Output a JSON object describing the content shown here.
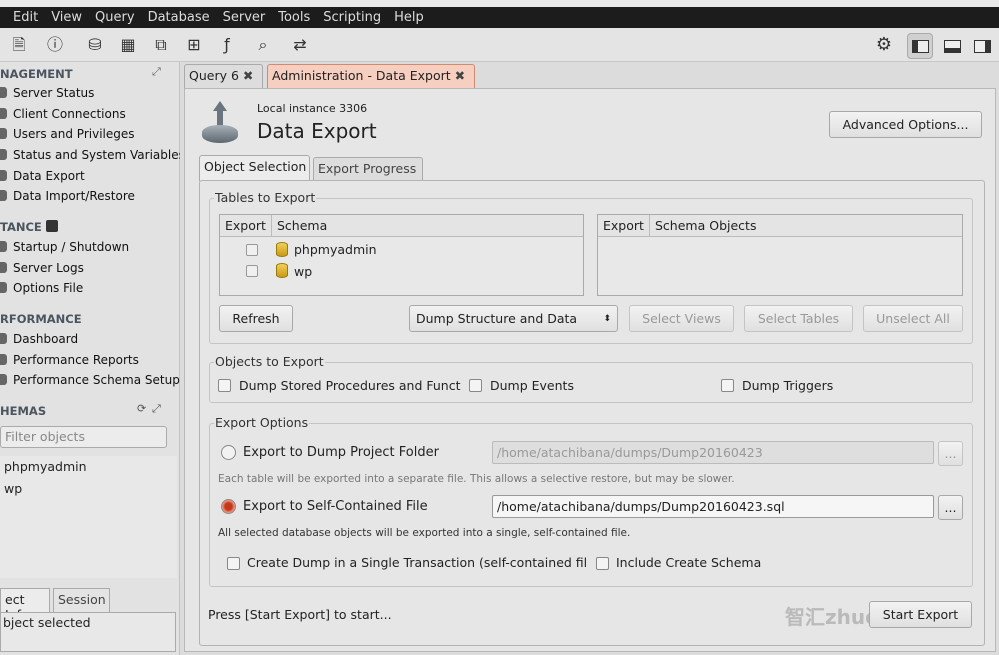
{
  "menu": [
    "Edit",
    "View",
    "Query",
    "Database",
    "Server",
    "Tools",
    "Scripting",
    "Help"
  ],
  "toolbar": {
    "icons": [
      "new-sql-tab-icon",
      "open-sql-file-icon",
      "inspector-icon",
      "create-schema-icon",
      "create-table-icon",
      "create-view-icon",
      "create-procedure-icon",
      "create-function-icon",
      "search-table-data-icon",
      "reconnect-icon"
    ],
    "right_icons": [
      "settings-icon",
      "toggle-sidebar-icon",
      "toggle-output-icon",
      "toggle-secondary-sidebar-icon"
    ]
  },
  "sidebar": {
    "management_title": "NAGEMENT",
    "management_items": [
      "Server Status",
      "Client Connections",
      "Users and Privileges",
      "Status and System Variables",
      "Data Export",
      "Data Import/Restore"
    ],
    "instance_title": "TANCE",
    "instance_items": [
      "Startup / Shutdown",
      "Server Logs",
      "Options File"
    ],
    "performance_title": "RFORMANCE",
    "performance_items": [
      "Dashboard",
      "Performance Reports",
      "Performance Schema Setup"
    ],
    "schemas_title": "HEMAS",
    "filter_placeholder": "Filter objects",
    "schemas": [
      "phpmyadmin",
      "wp"
    ],
    "bottom_tabs": [
      "ect Info",
      "Session"
    ],
    "info_text": "bject selected"
  },
  "tabs": [
    {
      "label": "Query 6",
      "active": false
    },
    {
      "label": "Administration - Data Export",
      "active": true
    }
  ],
  "header": {
    "instance": "Local instance 3306",
    "title": "Data Export",
    "advanced_button": "Advanced Options..."
  },
  "inner_tabs": [
    "Object Selection",
    "Export Progress"
  ],
  "tables_to_export": {
    "title": "Tables to Export",
    "left_headers": [
      "Export",
      "Schema"
    ],
    "rows": [
      {
        "export": false,
        "schema": "phpmyadmin"
      },
      {
        "export": false,
        "schema": "wp"
      }
    ],
    "right_headers": [
      "Export",
      "Schema Objects"
    ],
    "refresh": "Refresh",
    "dump_select": "Dump Structure and Data",
    "select_views": "Select Views",
    "select_tables": "Select Tables",
    "unselect_all": "Unselect All"
  },
  "objects_to_export": {
    "title": "Objects to Export",
    "options": [
      {
        "label": "Dump Stored Procedures and Funct",
        "checked": false
      },
      {
        "label": "Dump Events",
        "checked": false
      },
      {
        "label": "Dump Triggers",
        "checked": false
      }
    ]
  },
  "export_options": {
    "title": "Export Options",
    "folder_label": "Export to Dump Project Folder",
    "folder_selected": false,
    "folder_path": "/home/atachibana/dumps/Dump20160423",
    "folder_hint": "Each table will be exported into a separate file. This allows a selective restore, but may be slower.",
    "file_label": "Export to Self-Contained File",
    "file_selected": true,
    "file_path": "/home/atachibana/dumps/Dump20160423.sql",
    "file_hint": "All selected database objects will be exported into a single, self-contained file.",
    "browse": "...",
    "single_transaction": {
      "label": "Create Dump in a Single Transaction (self-contained fil",
      "checked": false
    },
    "include_schema": {
      "label": "Include Create Schema",
      "checked": false
    }
  },
  "status": "Press [Start Export] to start...",
  "start_export": "Start Export",
  "watermark": "智汇zhuon.com",
  "colors": {
    "accent": "#e35a3a",
    "active_tab_bg": "#f6cfc0"
  }
}
